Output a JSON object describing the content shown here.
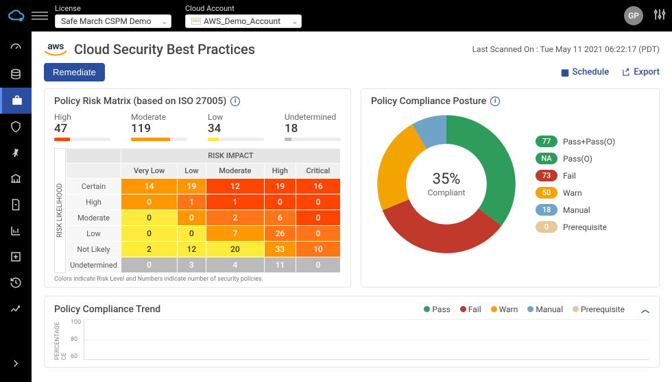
{
  "topbar": {
    "license_label": "License",
    "license_value": "Safe March CSPM Demo",
    "account_label": "Cloud Account",
    "account_value": "AWS_Demo_Account",
    "avatar": "GP"
  },
  "page": {
    "provider": "aws",
    "title": "Cloud Security Best Practices",
    "scanned_label": "Last Scanned On : Tue May 11 2021 06:22:17 (PDT)",
    "remediate_btn": "Remediate",
    "schedule_btn": "Schedule",
    "export_btn": "Export"
  },
  "risk": {
    "title": "Policy Risk Matrix (based on ISO 27005)",
    "summary": [
      {
        "label": "High",
        "value": "47",
        "color": "#ff4500",
        "width": "28%"
      },
      {
        "label": "Moderate",
        "value": "119",
        "color": "#ff9800",
        "width": "70%"
      },
      {
        "label": "Low",
        "value": "34",
        "color": "#ffeb3b",
        "width": "20%"
      },
      {
        "label": "Undetermined",
        "value": "18",
        "color": "#bbb",
        "width": "12%"
      }
    ],
    "impact_header": "RISK IMPACT",
    "likelihood_header": "RISK LIKELIHOOD",
    "cols": [
      "Very Low",
      "Low",
      "Moderate",
      "High",
      "Critical"
    ],
    "rows": [
      {
        "label": "Certain",
        "cells": [
          {
            "v": "14",
            "c": "orange1"
          },
          {
            "v": "19",
            "c": "orange1"
          },
          {
            "v": "12",
            "c": "red"
          },
          {
            "v": "19",
            "c": "red"
          },
          {
            "v": "16",
            "c": "red"
          }
        ]
      },
      {
        "label": "High",
        "cells": [
          {
            "v": "0",
            "c": "orange1"
          },
          {
            "v": "1",
            "c": "orange2"
          },
          {
            "v": "1",
            "c": "red"
          },
          {
            "v": "0",
            "c": "red"
          },
          {
            "v": "0",
            "c": "red"
          }
        ]
      },
      {
        "label": "Moderate",
        "cells": [
          {
            "v": "0",
            "c": "yellow"
          },
          {
            "v": "0",
            "c": "orange1"
          },
          {
            "v": "2",
            "c": "orange2"
          },
          {
            "v": "6",
            "c": "orange2"
          },
          {
            "v": "0",
            "c": "red"
          }
        ]
      },
      {
        "label": "Low",
        "cells": [
          {
            "v": "0",
            "c": "yellow"
          },
          {
            "v": "0",
            "c": "yellow"
          },
          {
            "v": "7",
            "c": "orange1"
          },
          {
            "v": "26",
            "c": "orange2"
          },
          {
            "v": "0",
            "c": "orange2"
          }
        ]
      },
      {
        "label": "Not Likely",
        "cells": [
          {
            "v": "2",
            "c": "yellow"
          },
          {
            "v": "12",
            "c": "yellow"
          },
          {
            "v": "20",
            "c": "yellow"
          },
          {
            "v": "33",
            "c": "orange1"
          },
          {
            "v": "10",
            "c": "orange2"
          }
        ]
      },
      {
        "label": "Undetermined",
        "cells": [
          {
            "v": "0",
            "c": "grey"
          },
          {
            "v": "3",
            "c": "grey"
          },
          {
            "v": "4",
            "c": "grey"
          },
          {
            "v": "11",
            "c": "grey"
          },
          {
            "v": "0",
            "c": "grey"
          }
        ]
      }
    ],
    "note": "Colors indicate Risk Level and Numbers indicate number of security policies."
  },
  "posture": {
    "title": "Policy Compliance Posture",
    "center_pct": "35%",
    "center_lbl": "Compliant",
    "legend": [
      {
        "badge": "77",
        "color": "#2e9d5b",
        "label": "Pass+Pass(O)"
      },
      {
        "badge": "NA",
        "color": "#2e9d5b",
        "label": "Pass(O)"
      },
      {
        "badge": "73",
        "color": "#c0392b",
        "label": "Fail"
      },
      {
        "badge": "50",
        "color": "#f4a400",
        "label": "Warn"
      },
      {
        "badge": "18",
        "color": "#6fa3c7",
        "label": "Manual"
      },
      {
        "badge": "0",
        "color": "#e6c99a",
        "label": "Prerequisite"
      }
    ]
  },
  "trend": {
    "title": "Policy Compliance Trend",
    "legend": [
      {
        "color": "#2e9d5b",
        "label": "Pass"
      },
      {
        "color": "#c0392b",
        "label": "Fail"
      },
      {
        "color": "#f4a400",
        "label": "Warn"
      },
      {
        "color": "#6fa3c7",
        "label": "Manual"
      },
      {
        "color": "#e6c99a",
        "label": "Prerequisite"
      }
    ],
    "ylabel": "CE PERCENTAGE",
    "yticks": [
      "100",
      "80",
      "60"
    ]
  },
  "chart_data": [
    {
      "type": "pie",
      "title": "Policy Compliance Posture",
      "series": [
        {
          "name": "Pass+Pass(O)",
          "value": 77,
          "color": "#2e9d5b"
        },
        {
          "name": "Fail",
          "value": 73,
          "color": "#c0392b"
        },
        {
          "name": "Warn",
          "value": 50,
          "color": "#f4a400"
        },
        {
          "name": "Manual",
          "value": 18,
          "color": "#6fa3c7"
        },
        {
          "name": "Prerequisite",
          "value": 0,
          "color": "#e6c99a"
        }
      ],
      "center_label": "35% Compliant"
    },
    {
      "type": "heatmap",
      "title": "Policy Risk Matrix (based on ISO 27005)",
      "xlabel": "RISK IMPACT",
      "ylabel": "RISK LIKELIHOOD",
      "x_categories": [
        "Very Low",
        "Low",
        "Moderate",
        "High",
        "Critical"
      ],
      "y_categories": [
        "Certain",
        "High",
        "Moderate",
        "Low",
        "Not Likely",
        "Undetermined"
      ],
      "values": [
        [
          14,
          19,
          12,
          19,
          16
        ],
        [
          0,
          1,
          1,
          0,
          0
        ],
        [
          0,
          0,
          2,
          6,
          0
        ],
        [
          0,
          0,
          7,
          26,
          0
        ],
        [
          2,
          12,
          20,
          33,
          10
        ],
        [
          0,
          3,
          4,
          11,
          0
        ]
      ]
    },
    {
      "type": "line",
      "title": "Policy Compliance Trend",
      "ylabel": "CE PERCENTAGE",
      "ylim": [
        0,
        100
      ],
      "series": [
        {
          "name": "Pass",
          "color": "#2e9d5b"
        },
        {
          "name": "Fail",
          "color": "#c0392b"
        },
        {
          "name": "Warn",
          "color": "#f4a400"
        },
        {
          "name": "Manual",
          "color": "#6fa3c7"
        },
        {
          "name": "Prerequisite",
          "color": "#e6c99a"
        }
      ]
    }
  ]
}
